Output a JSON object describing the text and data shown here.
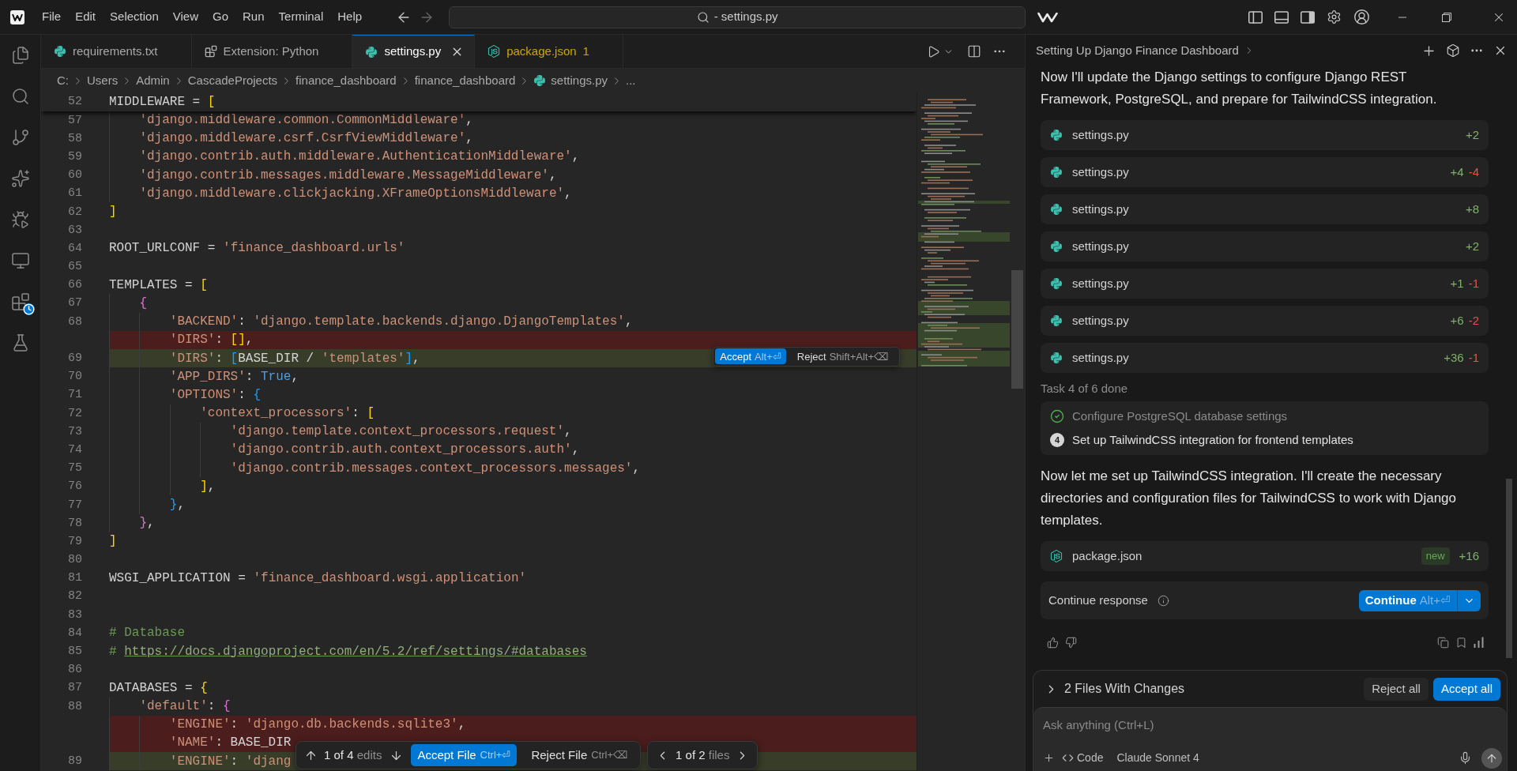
{
  "title_bar": {
    "menu": [
      "File",
      "Edit",
      "Selection",
      "View",
      "Go",
      "Run",
      "Terminal",
      "Help"
    ],
    "nav": [
      {
        "kind": "back",
        "disabled": false
      },
      {
        "kind": "forward",
        "disabled": true
      }
    ],
    "command_center": "- settings.py",
    "layout_toggles": [
      {
        "kind": "primary_sidebar",
        "on": false
      },
      {
        "kind": "panel",
        "on": false
      },
      {
        "kind": "secondary_sidebar",
        "on": true
      }
    ]
  },
  "activity_bar": {
    "items": [
      {
        "kind": "explorer"
      },
      {
        "kind": "search"
      },
      {
        "kind": "source_control"
      },
      {
        "kind": "ai"
      },
      {
        "kind": "run_debug"
      },
      {
        "kind": "remote"
      },
      {
        "kind": "extensions"
      },
      {
        "kind": "testing"
      }
    ]
  },
  "tabs": [
    {
      "label": "requirements.txt",
      "kind": "python",
      "selected": false,
      "warning": false
    },
    {
      "label": "Extension: Python",
      "kind": "extension",
      "selected": false,
      "warning": false
    },
    {
      "label": "settings.py",
      "kind": "python",
      "selected": true,
      "warning": false
    },
    {
      "label": "package.json",
      "kind": "node",
      "selected": false,
      "warning": true,
      "problems": "1"
    }
  ],
  "breadcrumb": [
    {
      "label": "C:",
      "kind": "folder"
    },
    {
      "label": "Users",
      "kind": "folder"
    },
    {
      "label": "Admin",
      "kind": "folder"
    },
    {
      "label": "CascadeProjects",
      "kind": "folder"
    },
    {
      "label": "finance_dashboard",
      "kind": "folder"
    },
    {
      "label": "finance_dashboard",
      "kind": "folder"
    },
    {
      "label": "settings.py",
      "kind": "python_file"
    },
    {
      "label": "...",
      "kind": "symbol"
    }
  ],
  "editor": {
    "sticky_line": {
      "number": "52",
      "tokens": [
        {
          "kind": "plain",
          "text": "MIDDLEWARE = "
        },
        {
          "kind": "bracket1",
          "text": "["
        }
      ]
    },
    "lines": [
      {
        "number": "57",
        "kind": "context",
        "tokens": [
          {
            "kind": "string",
            "text": "    'django.middleware.common.CommonMiddleware'"
          },
          {
            "kind": "plain",
            "text": ","
          }
        ]
      },
      {
        "number": "58",
        "kind": "context",
        "tokens": [
          {
            "kind": "string",
            "text": "    'django.middleware.csrf.CsrfViewMiddleware'"
          },
          {
            "kind": "plain",
            "text": ","
          }
        ]
      },
      {
        "number": "59",
        "kind": "context",
        "tokens": [
          {
            "kind": "string",
            "text": "    'django.contrib.auth.middleware.AuthenticationMiddleware'"
          },
          {
            "kind": "plain",
            "text": ","
          }
        ]
      },
      {
        "number": "60",
        "kind": "context",
        "tokens": [
          {
            "kind": "string",
            "text": "    'django.contrib.messages.middleware.MessageMiddleware'"
          },
          {
            "kind": "plain",
            "text": ","
          }
        ]
      },
      {
        "number": "61",
        "kind": "context",
        "tokens": [
          {
            "kind": "string",
            "text": "    'django.middleware.clickjacking.XFrameOptionsMiddleware'"
          },
          {
            "kind": "plain",
            "text": ","
          }
        ]
      },
      {
        "number": "62",
        "kind": "context",
        "tokens": [
          {
            "kind": "bracket1",
            "text": "]"
          }
        ]
      },
      {
        "number": "63",
        "kind": "context"
      },
      {
        "number": "64",
        "kind": "context",
        "tokens": [
          {
            "kind": "plain",
            "text": "ROOT_URLCONF = "
          },
          {
            "kind": "string",
            "text": "'finance_dashboard.urls'"
          }
        ]
      },
      {
        "number": "65",
        "kind": "context"
      },
      {
        "number": "66",
        "kind": "context",
        "tokens": [
          {
            "kind": "plain",
            "text": "TEMPLATES = "
          },
          {
            "kind": "bracket1",
            "text": "["
          }
        ]
      },
      {
        "number": "67",
        "kind": "context",
        "tokens": [
          {
            "kind": "bracket2",
            "text": "    {"
          }
        ]
      },
      {
        "number": "68",
        "kind": "context",
        "tokens": [
          {
            "kind": "string",
            "text": "        'BACKEND'"
          },
          {
            "kind": "plain",
            "text": ": "
          },
          {
            "kind": "string",
            "text": "'django.template.backends.django.DjangoTemplates'"
          },
          {
            "kind": "plain",
            "text": ","
          }
        ]
      },
      {
        "kind": "removed",
        "tokens": [
          {
            "kind": "string",
            "text": "        'DIRS'"
          },
          {
            "kind": "plain",
            "text": ": "
          },
          {
            "kind": "bracket1",
            "text": "[]"
          },
          {
            "kind": "plain",
            "text": ","
          }
        ]
      },
      {
        "number": "69",
        "kind": "added",
        "tokens": [
          {
            "kind": "string",
            "text": "        'DIRS'"
          },
          {
            "kind": "plain",
            "text": ": "
          },
          {
            "kind": "bracket3",
            "text": "["
          },
          {
            "kind": "plain",
            "text": "BASE_DIR / "
          },
          {
            "kind": "string",
            "text": "'templates'"
          },
          {
            "kind": "bracket3",
            "text": "]"
          },
          {
            "kind": "plain",
            "text": ","
          }
        ],
        "inline_actions": [
          {
            "label": "Accept",
            "shortcut": "Alt+⏎",
            "kind": "primary"
          },
          {
            "label": "Reject",
            "shortcut": "Shift+Alt+⌫",
            "kind": "secondary"
          }
        ]
      },
      {
        "number": "70",
        "kind": "context",
        "tokens": [
          {
            "kind": "string",
            "text": "        'APP_DIRS'"
          },
          {
            "kind": "plain",
            "text": ": "
          },
          {
            "kind": "keyword",
            "text": "True"
          },
          {
            "kind": "plain",
            "text": ","
          }
        ]
      },
      {
        "number": "71",
        "kind": "context",
        "tokens": [
          {
            "kind": "string",
            "text": "        'OPTIONS'"
          },
          {
            "kind": "plain",
            "text": ": "
          },
          {
            "kind": "bracket3",
            "text": "{"
          }
        ]
      },
      {
        "number": "72",
        "kind": "context",
        "tokens": [
          {
            "kind": "string",
            "text": "            'context_processors'"
          },
          {
            "kind": "plain",
            "text": ": "
          },
          {
            "kind": "bracket1",
            "text": "["
          }
        ]
      },
      {
        "number": "73",
        "kind": "context",
        "tokens": [
          {
            "kind": "string",
            "text": "                'django.template.context_processors.request'"
          },
          {
            "kind": "plain",
            "text": ","
          }
        ]
      },
      {
        "number": "74",
        "kind": "context",
        "tokens": [
          {
            "kind": "string",
            "text": "                'django.contrib.auth.context_processors.auth'"
          },
          {
            "kind": "plain",
            "text": ","
          }
        ]
      },
      {
        "number": "75",
        "kind": "context",
        "tokens": [
          {
            "kind": "string",
            "text": "                'django.contrib.messages.context_processors.messages'"
          },
          {
            "kind": "plain",
            "text": ","
          }
        ]
      },
      {
        "number": "76",
        "kind": "context",
        "tokens": [
          {
            "kind": "bracket1",
            "text": "            ]"
          },
          {
            "kind": "plain",
            "text": ","
          }
        ]
      },
      {
        "number": "77",
        "kind": "context",
        "tokens": [
          {
            "kind": "bracket3",
            "text": "        }"
          },
          {
            "kind": "plain",
            "text": ","
          }
        ]
      },
      {
        "number": "78",
        "kind": "context",
        "tokens": [
          {
            "kind": "bracket2",
            "text": "    }"
          },
          {
            "kind": "plain",
            "text": ","
          }
        ]
      },
      {
        "number": "79",
        "kind": "context",
        "tokens": [
          {
            "kind": "bracket1",
            "text": "]"
          }
        ]
      },
      {
        "number": "80",
        "kind": "context"
      },
      {
        "number": "81",
        "kind": "context",
        "tokens": [
          {
            "kind": "plain",
            "text": "WSGI_APPLICATION = "
          },
          {
            "kind": "string",
            "text": "'finance_dashboard.wsgi.application'"
          }
        ]
      },
      {
        "number": "82",
        "kind": "context"
      },
      {
        "number": "83",
        "kind": "context"
      },
      {
        "number": "84",
        "kind": "context",
        "tokens": [
          {
            "kind": "comment",
            "text": "# Database"
          }
        ]
      },
      {
        "number": "85",
        "kind": "context",
        "tokens": [
          {
            "kind": "comment",
            "text": "# "
          },
          {
            "kind": "link",
            "text": "https://docs.djangoproject.com/en/5.2/ref/settings/#databases"
          }
        ]
      },
      {
        "number": "86",
        "kind": "context"
      },
      {
        "number": "87",
        "kind": "context",
        "tokens": [
          {
            "kind": "plain",
            "text": "DATABASES = "
          },
          {
            "kind": "bracket1",
            "text": "{"
          }
        ]
      },
      {
        "number": "88",
        "kind": "context",
        "tokens": [
          {
            "kind": "string",
            "text": "    'default'"
          },
          {
            "kind": "plain",
            "text": ": "
          },
          {
            "kind": "bracket2",
            "text": "{"
          }
        ]
      },
      {
        "kind": "removed",
        "tokens": [
          {
            "kind": "string",
            "text": "        'ENGINE'"
          },
          {
            "kind": "plain",
            "text": ": "
          },
          {
            "kind": "string",
            "text": "'django.db.backends.sqlite3'"
          },
          {
            "kind": "plain",
            "text": ","
          }
        ]
      },
      {
        "kind": "removed",
        "tokens": [
          {
            "kind": "string",
            "text": "        'NAME'"
          },
          {
            "kind": "plain",
            "text": ": BASE_DIR"
          }
        ]
      },
      {
        "number": "89",
        "kind": "added",
        "tokens": [
          {
            "kind": "string",
            "text": "        'ENGINE'"
          },
          {
            "kind": "plain",
            "text": ": "
          },
          {
            "kind": "string",
            "text": "'djang"
          }
        ]
      }
    ],
    "review_bar": {
      "edits": {
        "position": "1 of 4",
        "unit": "edits"
      },
      "actions": [
        {
          "label": "Accept File",
          "shortcut": "Ctrl+⏎",
          "kind": "primary"
        },
        {
          "label": "Reject File",
          "shortcut": "Ctrl+⌫",
          "kind": "secondary"
        }
      ],
      "files": {
        "position": "1 of 2",
        "unit": "files"
      }
    }
  },
  "chat": {
    "title": "Setting Up Django Finance Dashboard",
    "blocks": [
      {
        "kind": "text",
        "text": "Now I'll update the Django settings to configure Django REST Framework, PostgreSQL, and prepare for TailwindCSS integration."
      },
      {
        "kind": "file_edit",
        "file": {
          "name": "settings.py",
          "kind": "python"
        },
        "added": "+2"
      },
      {
        "kind": "file_edit",
        "file": {
          "name": "settings.py",
          "kind": "python"
        },
        "added": "+4",
        "removed": "-4"
      },
      {
        "kind": "file_edit",
        "file": {
          "name": "settings.py",
          "kind": "python"
        },
        "added": "+8"
      },
      {
        "kind": "file_edit",
        "file": {
          "name": "settings.py",
          "kind": "python"
        },
        "added": "+2"
      },
      {
        "kind": "file_edit",
        "file": {
          "name": "settings.py",
          "kind": "python"
        },
        "added": "+1",
        "removed": "-1"
      },
      {
        "kind": "file_edit",
        "file": {
          "name": "settings.py",
          "kind": "python"
        },
        "added": "+6",
        "removed": "-2"
      },
      {
        "kind": "file_edit",
        "file": {
          "name": "settings.py",
          "kind": "python"
        },
        "added": "+36",
        "removed": "-1"
      },
      {
        "kind": "task_summary",
        "text": "Task 4 of 6 done"
      },
      {
        "kind": "task_list",
        "items": [
          {
            "text": "Configure PostgreSQL database settings",
            "done": true
          },
          {
            "text": "Set up TailwindCSS integration for frontend templates",
            "done": false,
            "step": "4"
          }
        ]
      },
      {
        "kind": "text",
        "text": "Now let me set up TailwindCSS integration. I'll create the necessary directories and configuration files for TailwindCSS to work with Django templates."
      },
      {
        "kind": "file_edit",
        "file": {
          "name": "package.json",
          "kind": "node"
        },
        "tag": "new",
        "added": "+16"
      },
      {
        "kind": "continue_prompt",
        "text": "Continue response",
        "button": "Continue",
        "shortcut": "Alt+⏎"
      }
    ]
  },
  "changes_bar": {
    "label": "2 Files With Changes",
    "expanded": false,
    "buttons": [
      {
        "label": "Reject all",
        "kind": "secondary"
      },
      {
        "label": "Accept all",
        "kind": "primary"
      }
    ]
  },
  "composer": {
    "placeholder": "Ask anything (Ctrl+L)",
    "mode": "Code",
    "model": "Claude Sonnet 4"
  }
}
